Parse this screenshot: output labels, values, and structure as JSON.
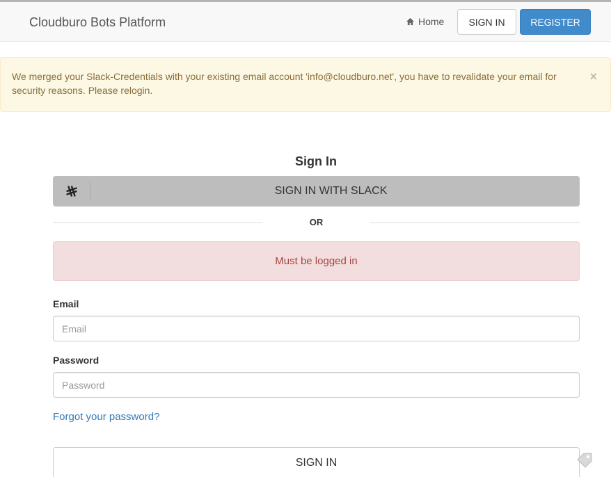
{
  "navbar": {
    "brand": "Cloudburo Bots Platform",
    "home_label": "Home",
    "signin_label": "SIGN IN",
    "register_label": "REGISTER"
  },
  "alert_warning": {
    "message": "We merged your Slack-Credentials with your existing email account 'info@cloudburo.net', you have to revalidate your email for security reasons. Please relogin.",
    "close": "×"
  },
  "signin": {
    "title": "Sign In",
    "slack_button": "SIGN IN WITH SLACK",
    "or_text": "OR",
    "error": "Must be logged in",
    "email_label": "Email",
    "email_placeholder": "Email",
    "password_label": "Password",
    "password_placeholder": "Password",
    "forgot_link": "Forgot your password?",
    "submit": "SIGN IN"
  },
  "colors": {
    "primary": "#428bca",
    "warning_bg": "#fcf8e3",
    "danger_bg": "#f2dede",
    "link": "#337ab7"
  },
  "icons": {
    "home": "home-icon",
    "slack": "slack-icon",
    "close": "close-icon"
  }
}
